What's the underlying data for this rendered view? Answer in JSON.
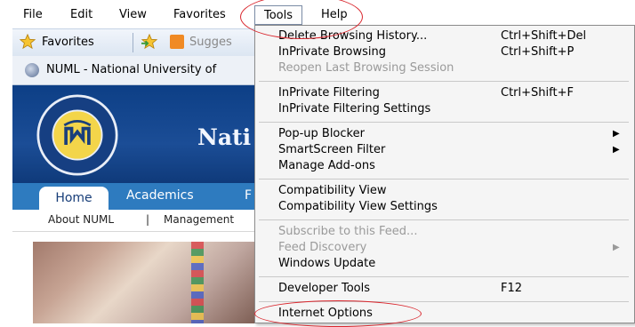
{
  "menubar": {
    "items": [
      {
        "label": "File"
      },
      {
        "label": "Edit"
      },
      {
        "label": "View"
      },
      {
        "label": "Favorites"
      },
      {
        "label": "Tools"
      },
      {
        "label": "Help"
      }
    ]
  },
  "favorites_bar": {
    "favorites_label": "Favorites",
    "suggested_label": "Sugges"
  },
  "tab": {
    "title": "NUML - National University of"
  },
  "site": {
    "title": "Nati",
    "nav": {
      "home": "Home",
      "academics": "Academics",
      "cut": "F"
    },
    "subnav": {
      "about": "About NUML",
      "sep": "|",
      "management": "Management"
    }
  },
  "tools_menu": {
    "items": [
      {
        "label": "Delete Browsing History...",
        "shortcut": "Ctrl+Shift+Del",
        "enabled": true
      },
      {
        "label": "InPrivate Browsing",
        "shortcut": "Ctrl+Shift+P",
        "enabled": true
      },
      {
        "label": "Reopen Last Browsing Session",
        "shortcut": "",
        "enabled": false
      },
      {
        "label": "InPrivate Filtering",
        "shortcut": "Ctrl+Shift+F",
        "enabled": true
      },
      {
        "label": "InPrivate Filtering Settings",
        "shortcut": "",
        "enabled": true
      },
      {
        "label": "Pop-up Blocker",
        "shortcut": "",
        "enabled": true,
        "submenu": true
      },
      {
        "label": "SmartScreen Filter",
        "shortcut": "",
        "enabled": true,
        "submenu": true
      },
      {
        "label": "Manage Add-ons",
        "shortcut": "",
        "enabled": true
      },
      {
        "label": "Compatibility View",
        "shortcut": "",
        "enabled": true
      },
      {
        "label": "Compatibility View Settings",
        "shortcut": "",
        "enabled": true
      },
      {
        "label": "Subscribe to this Feed...",
        "shortcut": "",
        "enabled": false
      },
      {
        "label": "Feed Discovery",
        "shortcut": "",
        "enabled": false,
        "submenu": true
      },
      {
        "label": "Windows Update",
        "shortcut": "",
        "enabled": true
      },
      {
        "label": "Developer Tools",
        "shortcut": "F12",
        "enabled": true
      },
      {
        "label": "Internet Options",
        "shortcut": "",
        "enabled": true
      }
    ]
  },
  "icons": {
    "favorites_star": "star-icon",
    "add_favorites": "add-to-favorites-icon",
    "suggested_sites": "suggested-sites-icon",
    "tab_page": "globe-icon",
    "submenu": "chevron-right-icon"
  },
  "colors": {
    "highlight": "#d9272e",
    "banner": "#0d3f86",
    "nav": "#2e7bbf"
  }
}
